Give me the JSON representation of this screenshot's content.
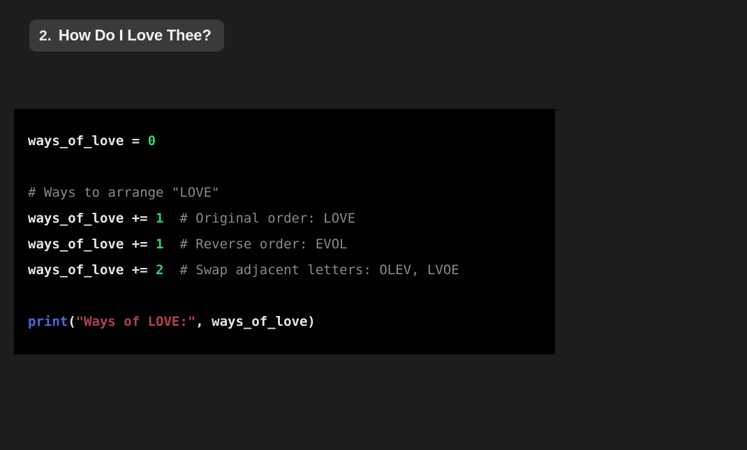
{
  "heading": {
    "number": "2.",
    "title": "How Do I Love Thee?"
  },
  "code": {
    "lines": [
      {
        "type": "assign",
        "ident": "ways_of_love",
        "op": " = ",
        "num": "0"
      },
      {
        "type": "blank"
      },
      {
        "type": "comment",
        "text": "# Ways to arrange \"LOVE\""
      },
      {
        "type": "aug",
        "ident": "ways_of_love",
        "op": " += ",
        "num": "1",
        "comment": "  # Original order: LOVE"
      },
      {
        "type": "aug",
        "ident": "ways_of_love",
        "op": " += ",
        "num": "1",
        "comment": "  # Reverse order: EVOL"
      },
      {
        "type": "aug",
        "ident": "ways_of_love",
        "op": " += ",
        "num": "2",
        "comment": "  # Swap adjacent letters: OLEV, LVOE"
      },
      {
        "type": "blank"
      },
      {
        "type": "print",
        "builtin": "print",
        "str": "\"Ways of LOVE:\"",
        "sep": ", ",
        "arg": "ways_of_love"
      }
    ]
  }
}
